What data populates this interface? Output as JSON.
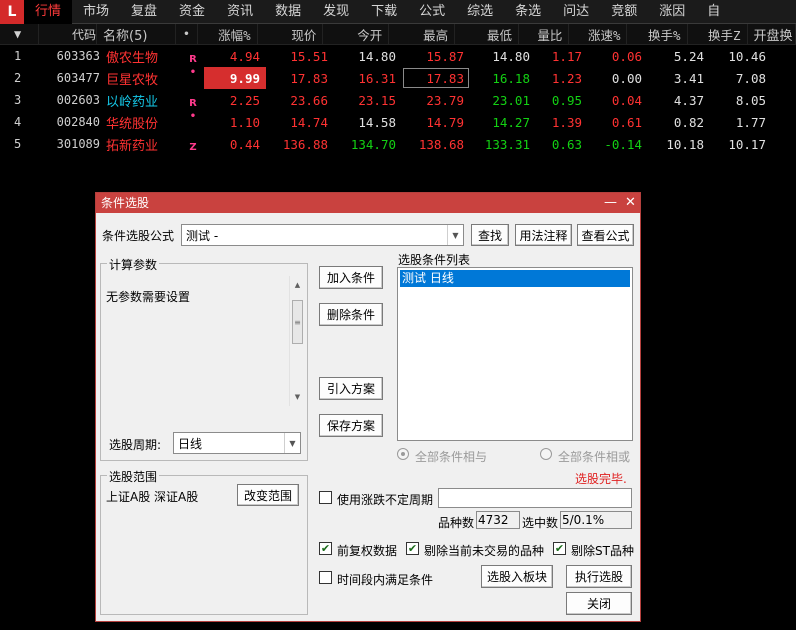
{
  "menu": {
    "logo": "L",
    "items": [
      "行情",
      "市场",
      "复盘",
      "资金",
      "资讯",
      "数据",
      "发现",
      "下载",
      "公式",
      "综选",
      "条选",
      "问达",
      "竞额",
      "涨因",
      "自"
    ],
    "active_index": 0
  },
  "grid": {
    "headers": {
      "sort_arrow": "▼",
      "code": "代码",
      "name": "名称(5)",
      "dot": "•",
      "zf": "涨幅%",
      "xj": "现价",
      "jk": "今开",
      "zg": "最高",
      "zd": "最低",
      "lb": "量比",
      "zs": "涨速%",
      "hs": "换手%",
      "hz": "换手Z",
      "kp": "开盘换"
    },
    "rows": [
      {
        "idx": "1",
        "code": "603363",
        "name": "傲农生物",
        "flag": "R",
        "zf": "4.94",
        "xj": "15.51",
        "jk": "14.80",
        "zg": "15.87",
        "zd": "14.80",
        "lb": "1.17",
        "zs": "0.06",
        "hs": "5.24",
        "hz": "10.46"
      },
      {
        "idx": "2",
        "code": "603477",
        "name": "巨星农牧",
        "flag": "•",
        "zf": "9.99",
        "xj": "17.83",
        "jk": "16.31",
        "zg": "17.83",
        "zd": "16.18",
        "lb": "1.23",
        "zs": "0.00",
        "hs": "3.41",
        "hz": "7.08"
      },
      {
        "idx": "3",
        "code": "002603",
        "name": "以岭药业",
        "flag": "R",
        "zf": "2.25",
        "xj": "23.66",
        "jk": "23.15",
        "zg": "23.79",
        "zd": "23.01",
        "lb": "0.95",
        "zs": "0.04",
        "hs": "4.37",
        "hz": "8.05"
      },
      {
        "idx": "4",
        "code": "002840",
        "name": "华统股份",
        "flag": "•",
        "zf": "1.10",
        "xj": "14.74",
        "jk": "14.58",
        "zg": "14.79",
        "zd": "14.27",
        "lb": "1.39",
        "zs": "0.61",
        "hs": "0.82",
        "hz": "1.77"
      },
      {
        "idx": "5",
        "code": "301089",
        "name": "拓新药业",
        "flag": "Z",
        "zf": "0.44",
        "xj": "136.88",
        "jk": "134.70",
        "zg": "138.68",
        "zd": "133.31",
        "lb": "0.63",
        "zs": "-0.14",
        "hs": "10.18",
        "hz": "10.17"
      }
    ]
  },
  "dialog": {
    "title": "条件选股",
    "min_glyph": "—",
    "close_glyph": "✕",
    "formula_label": "条件选股公式",
    "formula_value": "测试          -",
    "btn_find": "查找",
    "btn_usage": "用法注释",
    "btn_view": "查看公式",
    "params_group": "计算参数",
    "params_text": "无参数需要设置",
    "period_label": "选股周期:",
    "period_value": "日线",
    "range_group": "选股范围",
    "range_text": "上证A股 深证A股",
    "btn_change_range": "改变范围",
    "btn_add": "加入条件",
    "btn_delete": "删除条件",
    "btn_import": "引入方案",
    "btn_save": "保存方案",
    "list_label": "选股条件列表",
    "list_items": [
      "测试  日线"
    ],
    "radio_and": "全部条件相与",
    "radio_or": "全部条件相或",
    "status": "选股完毕.",
    "chk_uncertain": "使用涨跌不定周期",
    "count_label": "品种数",
    "count_value": "4732",
    "selected_label": "选中数",
    "selected_value": "5/0.1%",
    "chk_prerights": "前复权数据",
    "chk_remove_untraded": "剔除当前未交易的品种",
    "chk_remove_st": "剔除ST品种",
    "chk_time_range": "时间段内满足条件",
    "btn_to_block": "选股入板块",
    "btn_execute": "执行选股",
    "btn_close": "关闭",
    "check_glyph": "✔"
  },
  "colors": {
    "up": "#ff3232",
    "down": "#13d113",
    "title_bar": "#c9423f",
    "selection": "#0078d7"
  }
}
